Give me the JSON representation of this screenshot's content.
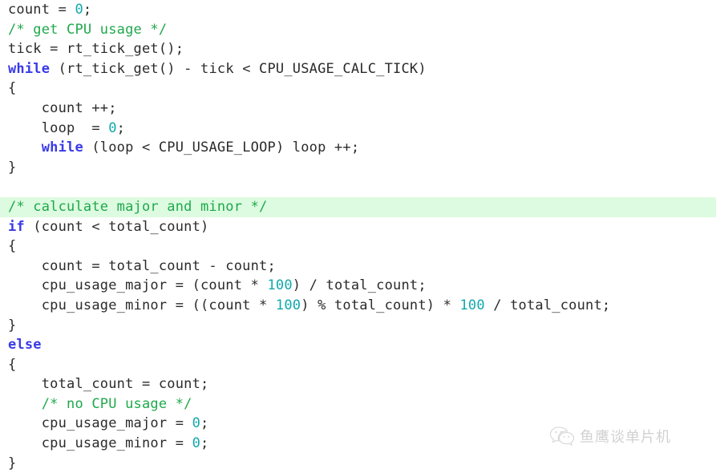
{
  "editor": {
    "language": "C",
    "highlight_color": "#ddfbe0",
    "colors": {
      "keyword": "#3a3ae8",
      "comment": "#1fa84c",
      "number": "#11a8ab",
      "plain": "#2b2b2b",
      "background": "#ffffff"
    },
    "lines": [
      {
        "id": "l1",
        "highlight": false,
        "tokens": [
          {
            "t": "count = ",
            "c": "plain"
          },
          {
            "t": "0",
            "c": "num"
          },
          {
            "t": ";",
            "c": "plain"
          }
        ]
      },
      {
        "id": "l2",
        "highlight": false,
        "tokens": [
          {
            "t": "/* get CPU usage */",
            "c": "cmt"
          }
        ]
      },
      {
        "id": "l3",
        "highlight": false,
        "tokens": [
          {
            "t": "tick = rt_tick_get();",
            "c": "plain"
          }
        ]
      },
      {
        "id": "l4",
        "highlight": false,
        "tokens": [
          {
            "t": "while",
            "c": "kw"
          },
          {
            "t": " (rt_tick_get() - tick < CPU_USAGE_CALC_TICK)",
            "c": "plain"
          }
        ]
      },
      {
        "id": "l5",
        "highlight": false,
        "tokens": [
          {
            "t": "{",
            "c": "plain"
          }
        ]
      },
      {
        "id": "l6",
        "highlight": false,
        "tokens": [
          {
            "t": "    count ++;",
            "c": "plain"
          }
        ]
      },
      {
        "id": "l7",
        "highlight": false,
        "tokens": [
          {
            "t": "    loop  = ",
            "c": "plain"
          },
          {
            "t": "0",
            "c": "num"
          },
          {
            "t": ";",
            "c": "plain"
          }
        ]
      },
      {
        "id": "l8",
        "highlight": false,
        "tokens": [
          {
            "t": "    ",
            "c": "plain"
          },
          {
            "t": "while",
            "c": "kw"
          },
          {
            "t": " (loop < CPU_USAGE_LOOP) loop ++;",
            "c": "plain"
          }
        ]
      },
      {
        "id": "l9",
        "highlight": false,
        "tokens": [
          {
            "t": "}",
            "c": "plain"
          }
        ]
      },
      {
        "id": "l10",
        "highlight": false,
        "tokens": [
          {
            "t": " ",
            "c": "plain"
          }
        ]
      },
      {
        "id": "l11",
        "highlight": true,
        "tokens": [
          {
            "t": "/* calculate major and minor */",
            "c": "cmt"
          }
        ]
      },
      {
        "id": "l12",
        "highlight": false,
        "tokens": [
          {
            "t": "if",
            "c": "kw"
          },
          {
            "t": " (count < total_count)",
            "c": "plain"
          }
        ]
      },
      {
        "id": "l13",
        "highlight": false,
        "tokens": [
          {
            "t": "{",
            "c": "plain"
          }
        ]
      },
      {
        "id": "l14",
        "highlight": false,
        "tokens": [
          {
            "t": "    count = total_count - count;",
            "c": "plain"
          }
        ]
      },
      {
        "id": "l15",
        "highlight": false,
        "tokens": [
          {
            "t": "    cpu_usage_major = (count * ",
            "c": "plain"
          },
          {
            "t": "100",
            "c": "num"
          },
          {
            "t": ") / total_count;",
            "c": "plain"
          }
        ]
      },
      {
        "id": "l16",
        "highlight": false,
        "tokens": [
          {
            "t": "    cpu_usage_minor = ((count * ",
            "c": "plain"
          },
          {
            "t": "100",
            "c": "num"
          },
          {
            "t": ") % total_count) * ",
            "c": "plain"
          },
          {
            "t": "100",
            "c": "num"
          },
          {
            "t": " / total_count;",
            "c": "plain"
          }
        ]
      },
      {
        "id": "l17",
        "highlight": false,
        "tokens": [
          {
            "t": "}",
            "c": "plain"
          }
        ]
      },
      {
        "id": "l18",
        "highlight": false,
        "tokens": [
          {
            "t": "else",
            "c": "kw"
          }
        ]
      },
      {
        "id": "l19",
        "highlight": false,
        "tokens": [
          {
            "t": "{",
            "c": "plain"
          }
        ]
      },
      {
        "id": "l20",
        "highlight": false,
        "tokens": [
          {
            "t": "    total_count = count;",
            "c": "plain"
          }
        ]
      },
      {
        "id": "l21",
        "highlight": false,
        "tokens": [
          {
            "t": "    ",
            "c": "plain"
          },
          {
            "t": "/* no CPU usage */",
            "c": "cmt"
          }
        ]
      },
      {
        "id": "l22",
        "highlight": false,
        "tokens": [
          {
            "t": "    cpu_usage_major = ",
            "c": "plain"
          },
          {
            "t": "0",
            "c": "num"
          },
          {
            "t": ";",
            "c": "plain"
          }
        ]
      },
      {
        "id": "l23",
        "highlight": false,
        "tokens": [
          {
            "t": "    cpu_usage_minor = ",
            "c": "plain"
          },
          {
            "t": "0",
            "c": "num"
          },
          {
            "t": ";",
            "c": "plain"
          }
        ]
      },
      {
        "id": "l24",
        "highlight": false,
        "tokens": [
          {
            "t": "}",
            "c": "plain"
          }
        ]
      }
    ]
  },
  "watermark": {
    "icon": "wechat-logo-icon",
    "text": "鱼鹰谈单片机",
    "color": "#8d8d8d"
  }
}
